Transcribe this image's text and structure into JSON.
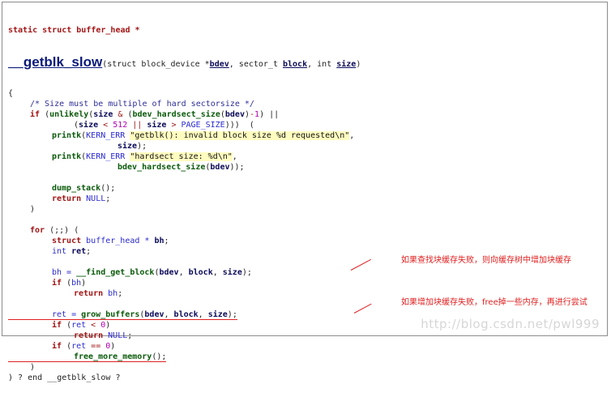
{
  "signature": {
    "line1": "static struct buffer_head *",
    "fn_name": "__getblk_slow",
    "params": [
      {
        "type": "(struct block_device *",
        "name": "bdev"
      },
      {
        "type": ", sector_t ",
        "name": "block"
      },
      {
        "type": ", int ",
        "name": "size"
      }
    ],
    "close": ")"
  },
  "code_lines": [
    {
      "indent": 0,
      "tokens": [
        [
          "pl",
          "{"
        ]
      ]
    },
    {
      "indent": 1,
      "tokens": [
        [
          "cm",
          "/* Size must be multiple of hard sectorsize */"
        ]
      ]
    },
    {
      "indent": 1,
      "tokens": [
        [
          "kw",
          "if "
        ],
        [
          "pl",
          "("
        ],
        [
          "fn",
          "unlikely"
        ],
        [
          "pl",
          "("
        ],
        [
          "var",
          "size"
        ],
        [
          "op",
          " & "
        ],
        [
          "pl",
          "("
        ],
        [
          "fn",
          "bdev_hardsect_size"
        ],
        [
          "pl",
          "("
        ],
        [
          "var",
          "bdev"
        ],
        [
          "pl",
          ")"
        ],
        [
          "op",
          "-"
        ],
        [
          "num",
          "1"
        ],
        [
          "pl",
          ") ||"
        ]
      ]
    },
    {
      "indent": 3,
      "tokens": [
        [
          "pl",
          "("
        ],
        [
          "var",
          "size"
        ],
        [
          "op",
          " < "
        ],
        [
          "num",
          "512"
        ],
        [
          "op",
          " || "
        ],
        [
          "var",
          "size"
        ],
        [
          "op",
          " > "
        ],
        [
          "ty",
          "PAGE_SIZE"
        ],
        [
          "pl",
          ")))  ("
        ]
      ]
    },
    {
      "indent": 2,
      "tokens": [
        [
          "fn",
          "printk"
        ],
        [
          "pl",
          "("
        ],
        [
          "ty",
          "KERN_ERR "
        ],
        [
          "str",
          "\"getblk(): invalid block size %d requested\\n\""
        ],
        [
          "pl",
          ","
        ]
      ]
    },
    {
      "indent": 5,
      "tokens": [
        [
          "var",
          "size"
        ],
        [
          "pl",
          ");"
        ]
      ]
    },
    {
      "indent": 2,
      "tokens": [
        [
          "fn",
          "printk"
        ],
        [
          "pl",
          "("
        ],
        [
          "ty",
          "KERN_ERR "
        ],
        [
          "str",
          "\"hardsect size: %d\\n\""
        ],
        [
          "pl",
          ","
        ]
      ]
    },
    {
      "indent": 5,
      "tokens": [
        [
          "fn",
          "bdev_hardsect_size"
        ],
        [
          "pl",
          "("
        ],
        [
          "var",
          "bdev"
        ],
        [
          "pl",
          "));"
        ]
      ]
    },
    {
      "indent": 0,
      "tokens": []
    },
    {
      "indent": 2,
      "tokens": [
        [
          "fn",
          "dump_stack"
        ],
        [
          "pl",
          "();"
        ]
      ]
    },
    {
      "indent": 2,
      "tokens": [
        [
          "kw",
          "return "
        ],
        [
          "ty",
          "NULL"
        ],
        [
          "pl",
          ";"
        ]
      ]
    },
    {
      "indent": 1,
      "tokens": [
        [
          "pl",
          ")"
        ]
      ]
    },
    {
      "indent": 0,
      "tokens": []
    },
    {
      "indent": 1,
      "tokens": [
        [
          "kw",
          "for "
        ],
        [
          "pl",
          "(;;) ("
        ]
      ]
    },
    {
      "indent": 2,
      "tokens": [
        [
          "kw",
          "struct "
        ],
        [
          "ty",
          "buffer_head * "
        ],
        [
          "var",
          "bh"
        ],
        [
          "pl",
          ";"
        ]
      ]
    },
    {
      "indent": 2,
      "tokens": [
        [
          "ty",
          "int "
        ],
        [
          "var",
          "ret"
        ],
        [
          "pl",
          ";"
        ]
      ]
    },
    {
      "indent": 0,
      "tokens": []
    },
    {
      "indent": 2,
      "tokens": [
        [
          "ty",
          "bh = "
        ],
        [
          "fn",
          "__find_get_block"
        ],
        [
          "pl",
          "("
        ],
        [
          "var",
          "bdev"
        ],
        [
          "pl",
          ", "
        ],
        [
          "var",
          "block"
        ],
        [
          "pl",
          ", "
        ],
        [
          "var",
          "size"
        ],
        [
          "pl",
          ");"
        ]
      ]
    },
    {
      "indent": 2,
      "tokens": [
        [
          "kw",
          "if "
        ],
        [
          "pl",
          "("
        ],
        [
          "ty",
          "bh"
        ],
        [
          "pl",
          ")"
        ]
      ]
    },
    {
      "indent": 3,
      "tokens": [
        [
          "kw",
          "return "
        ],
        [
          "ty",
          "bh"
        ],
        [
          "pl",
          ";"
        ]
      ]
    },
    {
      "indent": 0,
      "tokens": []
    },
    {
      "indent": 2,
      "underline": true,
      "tokens": [
        [
          "ty",
          "ret = "
        ],
        [
          "fn",
          "grow_buffers"
        ],
        [
          "pl",
          "("
        ],
        [
          "var",
          "bdev"
        ],
        [
          "pl",
          ", "
        ],
        [
          "var",
          "block"
        ],
        [
          "pl",
          ", "
        ],
        [
          "var",
          "size"
        ],
        [
          "pl",
          ");"
        ]
      ]
    },
    {
      "indent": 2,
      "tokens": [
        [
          "kw",
          "if "
        ],
        [
          "pl",
          "("
        ],
        [
          "ty",
          "ret"
        ],
        [
          "op",
          " < "
        ],
        [
          "num",
          "0"
        ],
        [
          "pl",
          ")"
        ]
      ]
    },
    {
      "indent": 3,
      "tokens": [
        [
          "kw",
          "return "
        ],
        [
          "ty",
          "NULL"
        ],
        [
          "pl",
          ";"
        ]
      ]
    },
    {
      "indent": 2,
      "tokens": [
        [
          "kw",
          "if "
        ],
        [
          "pl",
          "("
        ],
        [
          "ty",
          "ret"
        ],
        [
          "op",
          " == "
        ],
        [
          "num",
          "0"
        ],
        [
          "pl",
          ")"
        ]
      ]
    },
    {
      "indent": 3,
      "underline": true,
      "tokens": [
        [
          "fn",
          "free_more_memory"
        ],
        [
          "pl",
          "();"
        ]
      ]
    },
    {
      "indent": 1,
      "tokens": [
        [
          "pl",
          ")"
        ]
      ]
    },
    {
      "indent": 0,
      "tokens": [
        [
          "pl",
          ") ? end __getblk_slow ?"
        ]
      ]
    }
  ],
  "annotations": [
    {
      "text": "如果查找块缓存失败，则向缓存树中增加块缓存"
    },
    {
      "text": "如果增加块缓存失败，free掉一些内存，再进行尝试"
    }
  ],
  "watermark": "http://blog.csdn.net/pwl999",
  "colors": {
    "keyword": "#a31515",
    "function": "#0a5a0a",
    "annotation": "#e02020",
    "title": "#0a1a7a"
  }
}
